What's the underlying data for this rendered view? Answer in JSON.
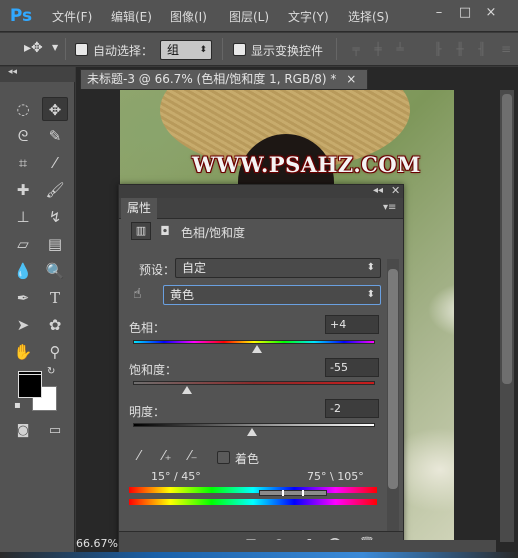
{
  "app": {
    "logo": "Ps"
  },
  "menu": [
    "文件(F)",
    "编辑(E)",
    "图像(I)",
    "图层(L)",
    "文字(Y)",
    "选择(S)"
  ],
  "window_controls": {
    "minimize": "–",
    "maximize": "□",
    "close": "×"
  },
  "options": {
    "auto_select_label": "自动选择：",
    "auto_select_target": "组",
    "show_transform_label": "显示变换控件"
  },
  "document": {
    "tab_title": "未标题-3 @ 66.7% (色相/饱和度 1, RGB/8) *",
    "tab_close": "×",
    "watermark": "WWW.PSAHZ.COM",
    "zoom": "66.67%"
  },
  "properties": {
    "tab_label": "属性",
    "adjustment_title": "色相/饱和度",
    "preset_label": "预设：",
    "preset_value": "自定",
    "channel_value": "黄色",
    "hue_label": "色相：",
    "hue_value": "+4",
    "hue_level": 4,
    "saturation_label": "饱和度：",
    "saturation_value": "-55",
    "saturation_level": -55,
    "lightness_label": "明度：",
    "lightness_value": "-2",
    "lightness_level": -2,
    "colorize_label": "着色",
    "range_left": "15° / 45°",
    "range_right": "75° \\ 105°"
  },
  "icons": {
    "tools": [
      "marquee-icon",
      "move-icon",
      "lasso-icon",
      "quick-select-icon",
      "crop-icon",
      "eyedropper-icon",
      "healing-icon",
      "brush-icon",
      "stamp-icon",
      "history-brush-icon",
      "eraser-icon",
      "gradient-icon",
      "blur-icon",
      "dodge-icon",
      "pen-icon",
      "type-icon",
      "path-select-icon",
      "shape-icon",
      "hand-icon",
      "zoom-icon"
    ]
  },
  "colors": {
    "accent": "#31a8ff",
    "panel_bg": "#535353",
    "watermark_outline": "#6b0000"
  }
}
